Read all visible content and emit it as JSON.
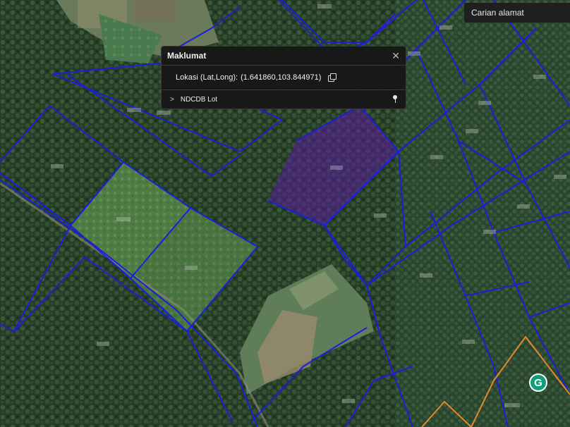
{
  "search": {
    "label": "Carian alamat"
  },
  "info_panel": {
    "title": "Maklumat",
    "coord_label": "Lokasi (Lat,Long):",
    "coord_value": "(1.641860,103.844971)",
    "lot_layer": "NDCDB Lot"
  },
  "badge": {
    "letter": "G"
  },
  "colors": {
    "lot_boundary": "#1a1fd8",
    "selected_fill": "#5a1aa0",
    "orange_boundary": "#e38a2a"
  },
  "icons": [
    "close-icon",
    "copy-icon",
    "chevron-right-icon",
    "pin-icon",
    "grammarly-icon"
  ]
}
